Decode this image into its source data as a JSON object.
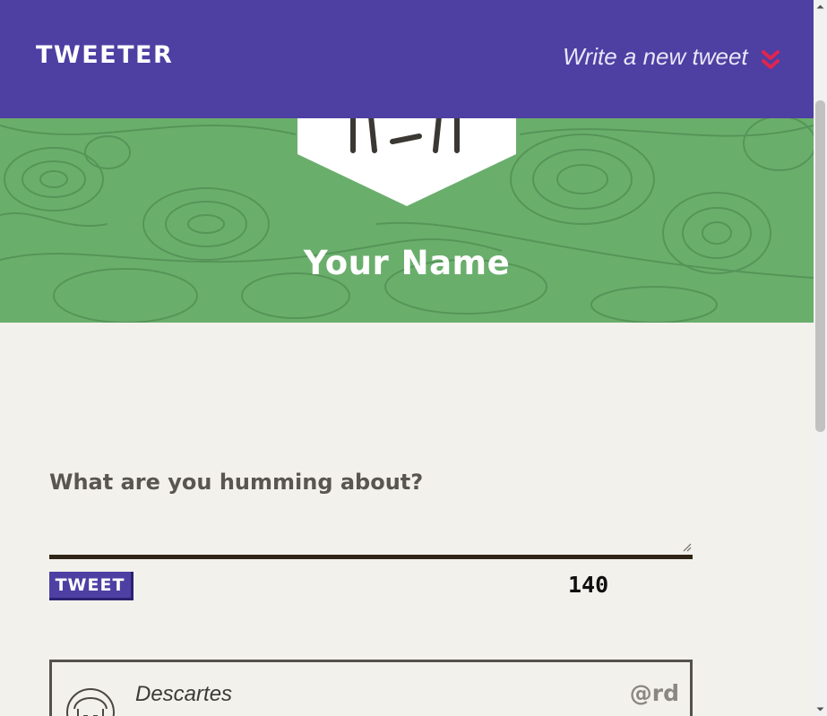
{
  "nav": {
    "brand": "TWEETER",
    "compose_label": "Write a new tweet",
    "compose_icon": "double-chevron-down-icon",
    "accent_color": "#e0254f"
  },
  "profile": {
    "name": "Your Name",
    "avatar_icon": "avatar-icon",
    "banner_color": "#6aae6c"
  },
  "composer": {
    "prompt": "What are you humming about?",
    "input_value": "",
    "button_label": "TWEET",
    "char_count": "140"
  },
  "tweets": [
    {
      "author": "Descartes",
      "handle": "@rd",
      "avatar_icon": "user-avatar-icon"
    }
  ],
  "theme": {
    "nav_color": "#4e3fa3",
    "page_bg": "#f3f1ec"
  }
}
